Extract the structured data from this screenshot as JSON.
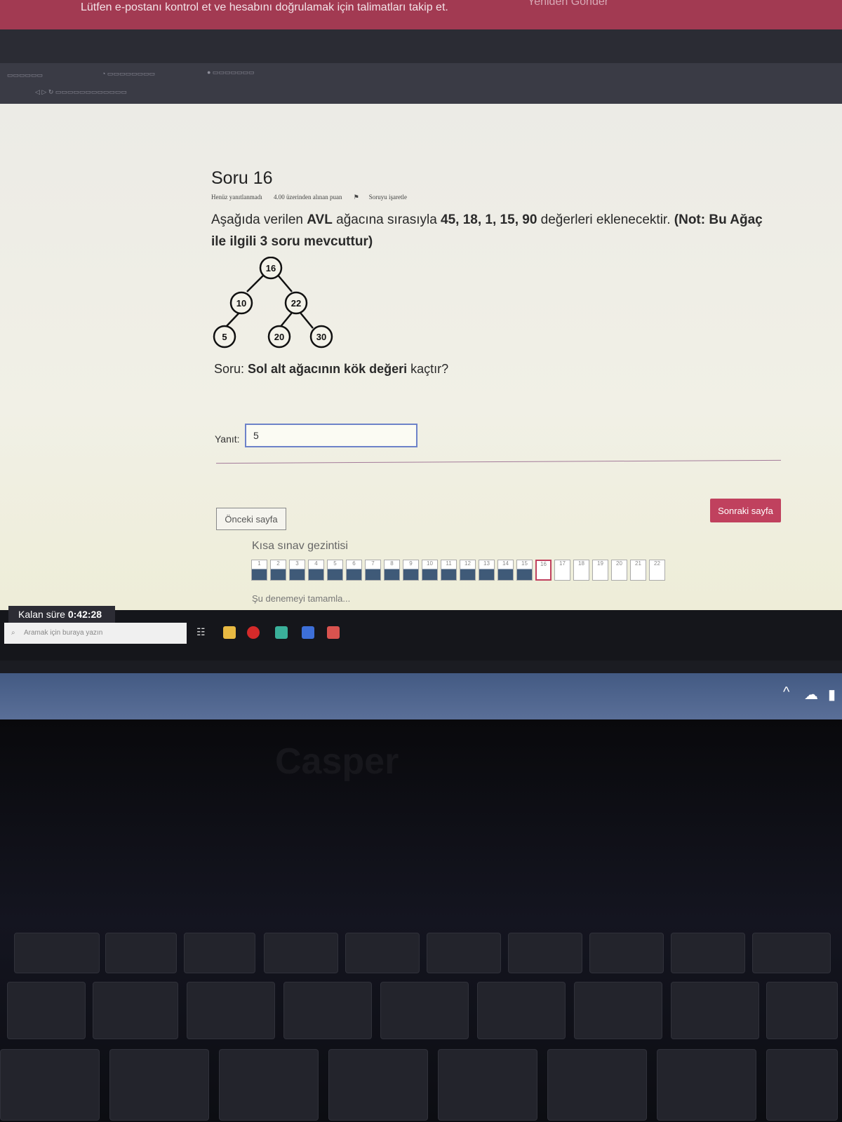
{
  "banner": {
    "message": "Lütfen e-postanı kontrol et ve hesabını doğrulamak için talimatları takip et.",
    "resend": "Yeniden Gönder"
  },
  "question": {
    "title": "Soru 16",
    "status": "Henüz yanıtlanmadı",
    "points": "4.00 üzerinden alınan puan",
    "flag": "Soruyu işaretle",
    "text_pre": "Aşağıda verilen ",
    "text_bold1": "AVL",
    "text_mid": " ağacına sırasıyla ",
    "text_bold2": "45, 18, 1, 15, 90",
    "text_mid2": " değerleri eklenecektir. ",
    "text_bold3": "(Not: Bu Ağaç ile ilgili 3 soru mevcuttur)",
    "prompt_label": "Soru: ",
    "prompt_bold": "Sol alt ağacının kök değeri",
    "prompt_end": " kaçtır?"
  },
  "tree": {
    "root": "16",
    "left": "10",
    "right": "22",
    "left_left": "5",
    "right_left": "20",
    "right_right": "30"
  },
  "answer": {
    "label": "Yanıt:",
    "value": "5"
  },
  "nav": {
    "prev": "Önceki sayfa",
    "next": "Sonraki sayfa",
    "title": "Kısa sınav gezintisi",
    "cells": [
      "1",
      "2",
      "3",
      "4",
      "5",
      "6",
      "7",
      "8",
      "9",
      "10",
      "11",
      "12",
      "13",
      "14",
      "15",
      "16",
      "17",
      "18",
      "19",
      "20",
      "21",
      "22"
    ],
    "answered_count": 15,
    "current": "16",
    "finish": "Şu denemeyi tamamla..."
  },
  "timer": {
    "label": "Kalan süre ",
    "value": "0:42:28"
  },
  "taskbar": {
    "search_placeholder": "Aramak için buraya yazın"
  },
  "laptop": {
    "brand": "Casper"
  },
  "colors": {
    "accent": "#c0415e",
    "banner": "#a23a52",
    "answered": "#3f5a78",
    "input_border": "#6d82c9"
  }
}
